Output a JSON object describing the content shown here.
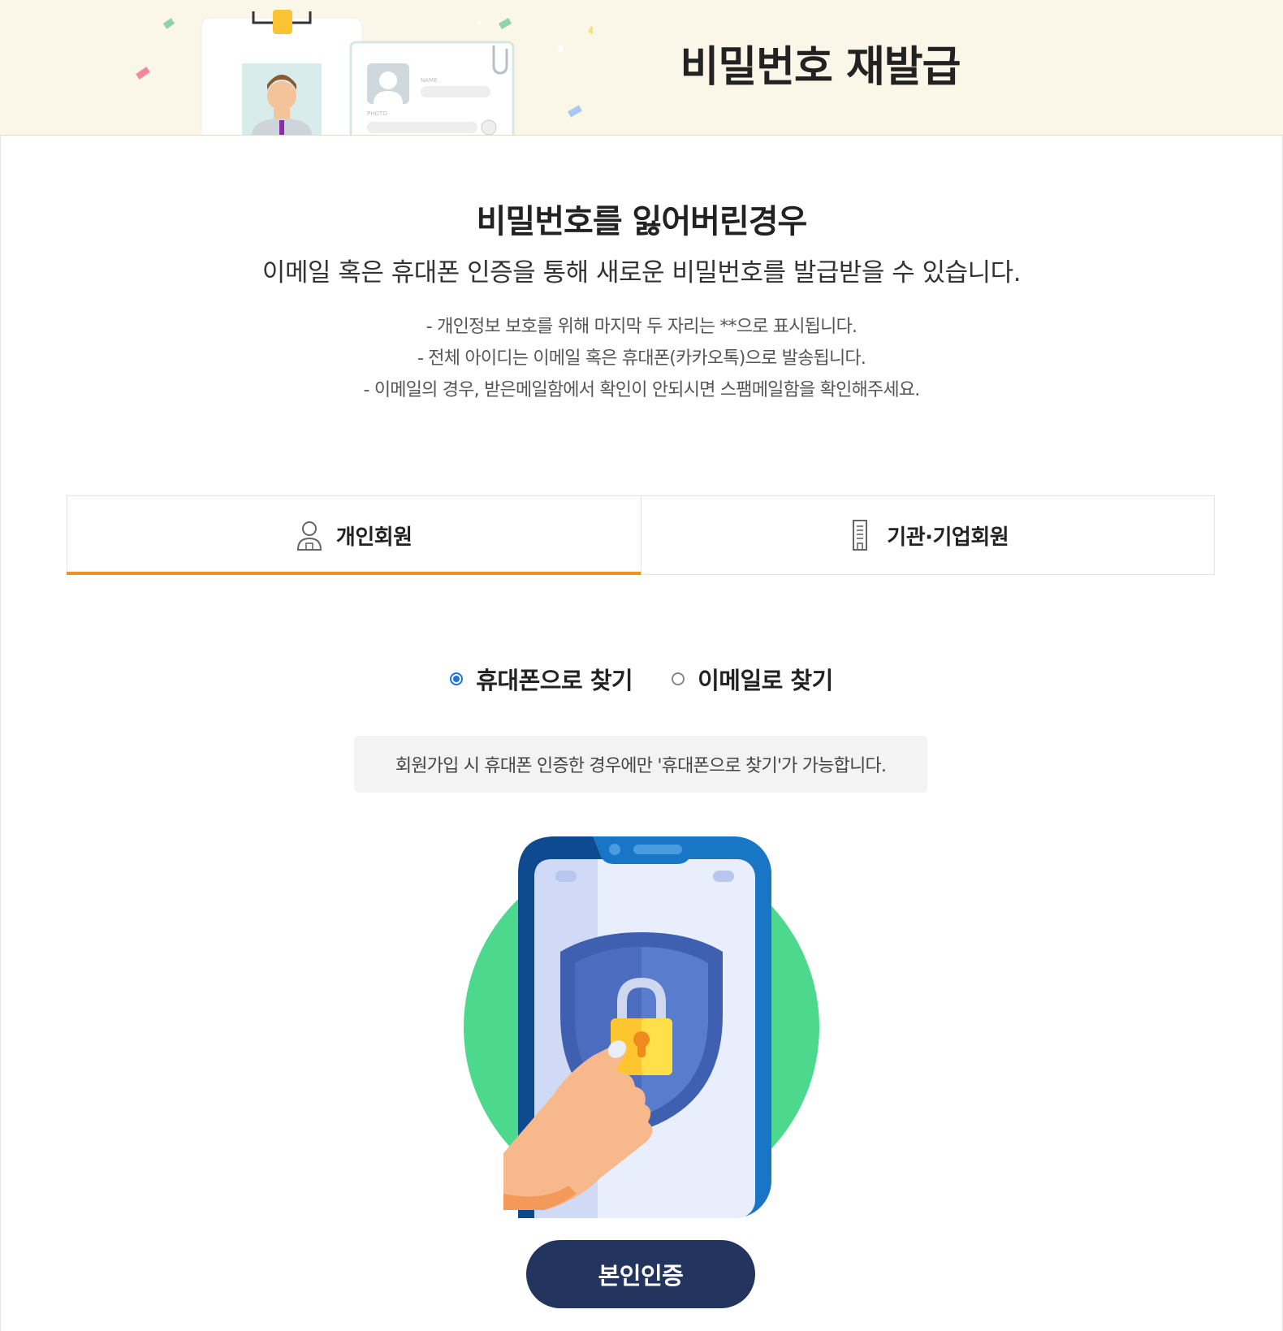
{
  "header": {
    "title": "비밀번호 재발급"
  },
  "intro": {
    "heading": "비밀번호를 잃어버린경우",
    "description": "이메일 혹은 휴대폰 인증을 통해 새로운 비밀번호를 발급받을 수 있습니다.",
    "notes": [
      "- 개인정보 보호를 위해 마지막 두 자리는 **으로 표시됩니다.",
      "- 전체 아이디는 이메일 혹은 휴대폰(카카오톡)으로 발송됩니다.",
      "- 이메일의 경우, 받은메일함에서 확인이 안되시면 스팸메일함을 확인해주세요."
    ]
  },
  "tabs": [
    {
      "label": "개인회원",
      "icon": "person-icon",
      "active": true
    },
    {
      "label": "기관·기업회원",
      "icon": "building-icon",
      "active": false
    }
  ],
  "search_method": {
    "options": [
      {
        "label": "휴대폰으로 찾기",
        "checked": true
      },
      {
        "label": "이메일로 찾기",
        "checked": false
      }
    ]
  },
  "info_message": "회원가입 시 휴대폰 인증한 경우에만 '휴대폰으로 찾기'가 가능합니다.",
  "verify_button": {
    "label": "본인인증"
  },
  "colors": {
    "banner_bg": "#fbf7e8",
    "active_tab_underline": "#f0931e",
    "radio_checked": "#1a73e8",
    "button_bg": "#23345f",
    "info_box_bg": "#f3f3f3"
  }
}
